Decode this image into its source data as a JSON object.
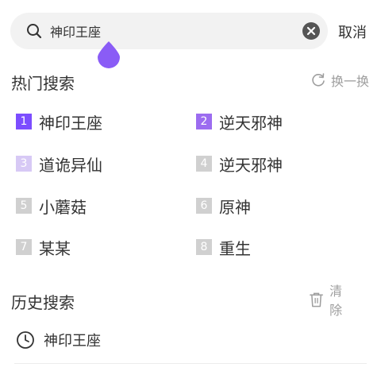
{
  "search": {
    "value": "神印王座",
    "cancel_label": "取消"
  },
  "hot": {
    "title": "热门搜索",
    "refresh_label": "换一换",
    "items": [
      {
        "rank": "1",
        "label": "神印王座",
        "color": "#7c4dff"
      },
      {
        "rank": "2",
        "label": "逆天邪神",
        "color": "#9c6cf0"
      },
      {
        "rank": "3",
        "label": "道诡异仙",
        "color": "#d7c9f5"
      },
      {
        "rank": "4",
        "label": "逆天邪神",
        "color": "#d0d0d0"
      },
      {
        "rank": "5",
        "label": "小蘑菇",
        "color": "#d0d0d0"
      },
      {
        "rank": "6",
        "label": "原神",
        "color": "#d0d0d0"
      },
      {
        "rank": "7",
        "label": "某某",
        "color": "#d0d0d0"
      },
      {
        "rank": "8",
        "label": "重生",
        "color": "#d0d0d0"
      }
    ]
  },
  "history": {
    "title": "历史搜索",
    "clear_label": "清除",
    "items": [
      {
        "label": "神印王座"
      }
    ]
  },
  "colors": {
    "accent": "#8a5cf6",
    "muted": "#9e9e9e"
  }
}
